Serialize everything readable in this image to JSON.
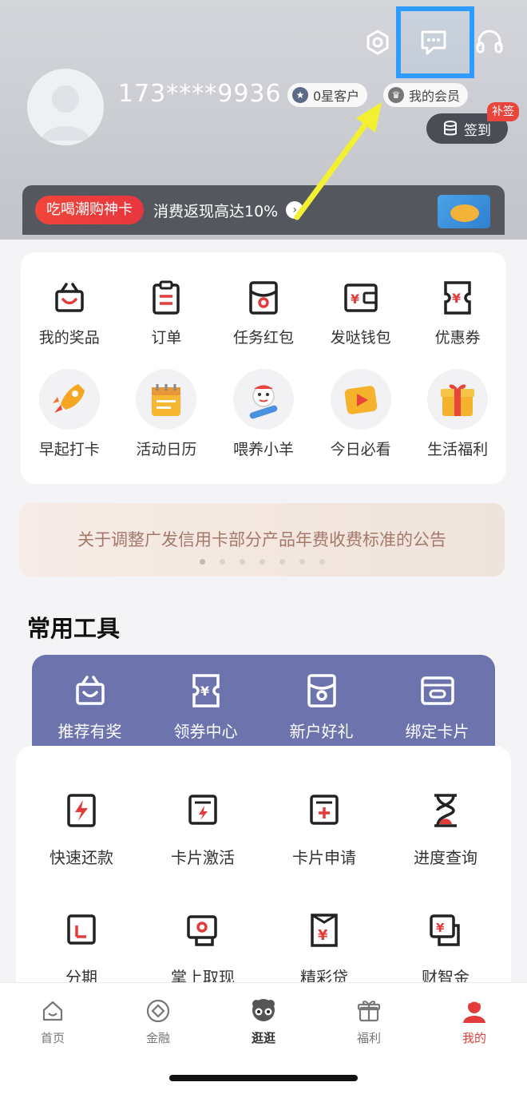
{
  "header": {
    "phone": "173****9936",
    "level_badge": "0星客户",
    "member_badge": "我的会员",
    "signin_label": "签到",
    "buqian_tag": "补签",
    "top_icons": [
      "settings-icon",
      "message-icon",
      "headset-icon"
    ]
  },
  "promo": {
    "tag": "吃喝潮购神卡",
    "text": "消费返现高达10%"
  },
  "quick_row1": [
    {
      "label": "我的奖品",
      "icon": "gift-box-icon"
    },
    {
      "label": "订单",
      "icon": "clipboard-icon"
    },
    {
      "label": "任务红包",
      "icon": "red-envelope-icon"
    },
    {
      "label": "发哒钱包",
      "icon": "wallet-icon"
    },
    {
      "label": "优惠券",
      "icon": "coupon-icon"
    }
  ],
  "quick_row2": [
    {
      "label": "早起打卡",
      "icon": "rocket-icon"
    },
    {
      "label": "活动日历",
      "icon": "calendar-icon"
    },
    {
      "label": "喂养小羊",
      "icon": "sheep-icon"
    },
    {
      "label": "今日必看",
      "icon": "video-icon"
    },
    {
      "label": "生活福利",
      "icon": "present-icon"
    }
  ],
  "notice": {
    "text": "关于调整广发信用卡部分产品年费收费标准的公告",
    "dot_count": 7,
    "active_dot": 0
  },
  "tools": {
    "title": "常用工具",
    "band": [
      {
        "label": "推荐有奖",
        "icon": "gift-box-icon"
      },
      {
        "label": "领券中心",
        "icon": "coupon-icon"
      },
      {
        "label": "新户好礼",
        "icon": "red-envelope-icon"
      },
      {
        "label": "绑定卡片",
        "icon": "card-link-icon"
      }
    ],
    "row1": [
      {
        "label": "快速还款",
        "icon": "fast-repay-icon"
      },
      {
        "label": "卡片激活",
        "icon": "card-activate-icon"
      },
      {
        "label": "卡片申请",
        "icon": "card-apply-icon"
      },
      {
        "label": "进度查询",
        "icon": "hourglass-icon"
      }
    ],
    "row2": [
      {
        "label": "分期",
        "icon": "installment-icon"
      },
      {
        "label": "掌上取现",
        "icon": "cash-withdraw-icon"
      },
      {
        "label": "精彩贷",
        "icon": "loan-icon"
      },
      {
        "label": "财智金",
        "icon": "finance-icon"
      }
    ]
  },
  "tabbar": [
    {
      "label": "首页",
      "icon": "home-icon"
    },
    {
      "label": "金融",
      "icon": "finance-tab-icon"
    },
    {
      "label": "逛逛",
      "icon": "stroll-icon"
    },
    {
      "label": "福利",
      "icon": "gift-tab-icon"
    },
    {
      "label": "我的",
      "icon": "profile-icon"
    }
  ],
  "colors": {
    "brand_red": "#e23c3a",
    "tools_band": "#6d74ad",
    "highlight_box": "#2f9bff",
    "arrow": "#f2f030"
  }
}
